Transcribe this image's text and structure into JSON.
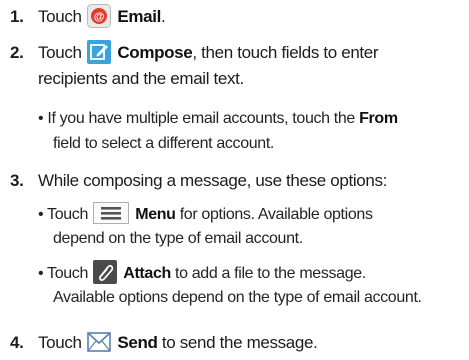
{
  "steps": [
    {
      "number": "1.",
      "lines": [
        {
          "pre": "Touch",
          "icon": "email-app-icon",
          "bold": "Email",
          "post": "."
        }
      ]
    },
    {
      "number": "2.",
      "lines": [
        {
          "pre": "Touch",
          "icon": "compose-icon",
          "bold": "Compose",
          "post": ", then touch fields to enter"
        },
        {
          "text": "recipients and the email text."
        }
      ],
      "bullets": [
        {
          "lines": [
            {
              "pre": "• If you have multiple email accounts, touch the",
              "bold": "From"
            },
            {
              "text": "field to select a different account."
            }
          ]
        }
      ]
    },
    {
      "number": "3.",
      "lines": [
        {
          "text": "While composing a message, use these options:"
        }
      ],
      "bullets": [
        {
          "lines": [
            {
              "pre": "• Touch",
              "icon": "menu-key-icon",
              "bold": "Menu",
              "post": " for options. Available options"
            },
            {
              "text": "depend on the type of email account."
            }
          ]
        },
        {
          "lines": [
            {
              "pre": "• Touch",
              "icon": "attach-paperclip-icon",
              "bold": "Attach",
              "post": " to add a file to the message."
            },
            {
              "text": "Available options depend on the type of email account."
            }
          ]
        }
      ]
    },
    {
      "number": "4.",
      "lines": [
        {
          "pre": "Touch",
          "icon": "send-envelope-icon",
          "bold": "Send",
          "post": " to send the message."
        }
      ]
    }
  ],
  "colors": {
    "email_icon_red": "#e23b2e",
    "compose_icon_blue": "#3aa3dc",
    "menu_icon_gray": "#555555",
    "send_icon_blue": "#5a7fb0"
  }
}
